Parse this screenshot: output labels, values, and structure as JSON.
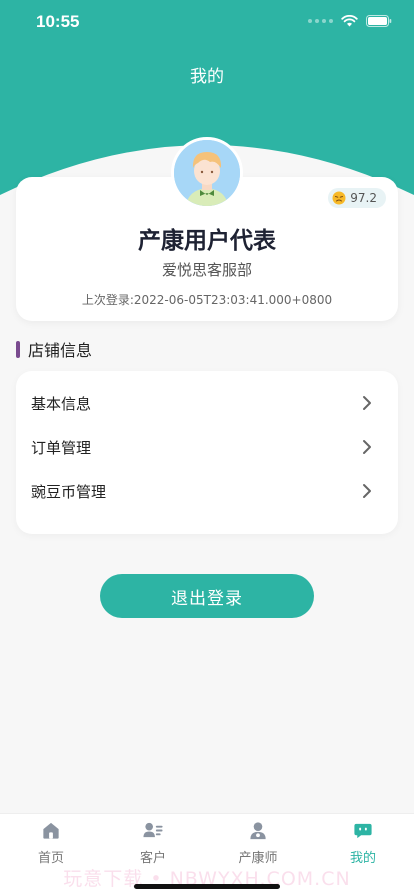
{
  "status_bar": {
    "time": "10:55"
  },
  "page": {
    "title": "我的"
  },
  "profile": {
    "score": "97.2",
    "name": "产康用户代表",
    "organization": "爱悦思客服部",
    "last_login": "上次登录:2022-06-05T23:03:41.000+0800"
  },
  "store_section": {
    "title": "店铺信息",
    "items": [
      {
        "label": "基本信息"
      },
      {
        "label": "订单管理"
      },
      {
        "label": "豌豆币管理"
      }
    ]
  },
  "logout": {
    "label": "退出登录"
  },
  "tab_bar": {
    "tabs": [
      {
        "label": "首页",
        "icon": "home-icon"
      },
      {
        "label": "客户",
        "icon": "customer-card-icon"
      },
      {
        "label": "产康师",
        "icon": "therapist-icon"
      },
      {
        "label": "我的",
        "icon": "me-chat-icon"
      }
    ],
    "active_color": "#2db4a4"
  },
  "watermark": "玩意下载 • NBWYXH.COM.CN",
  "colors": {
    "brand_teal": "#2db4a4",
    "section_accent": "#7a4b8f",
    "page_background": "#f7f7f7"
  }
}
